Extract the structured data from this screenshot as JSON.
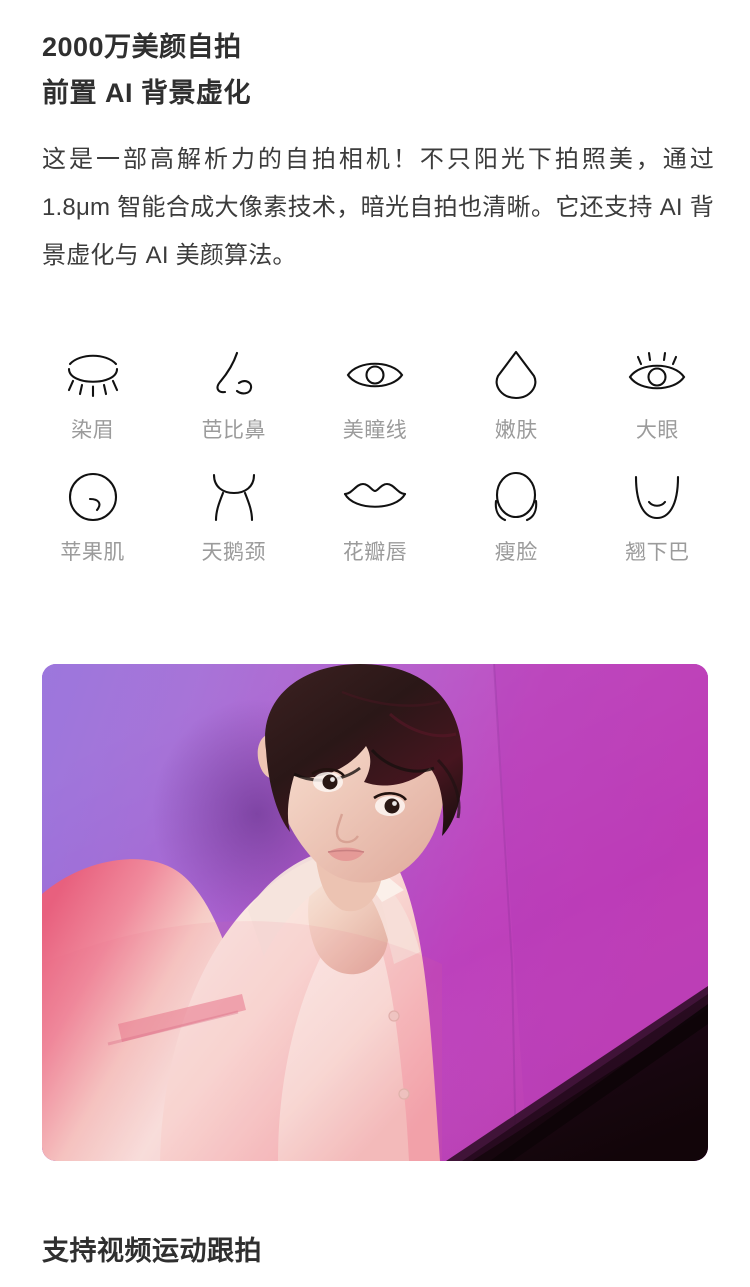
{
  "headings": {
    "line1": "2000万美颜自拍",
    "line2": "前置 AI 背景虚化",
    "bottom": "支持视频运动跟拍"
  },
  "paragraph": "这是一部高解析力的自拍相机！不只阳光下拍照美，通过 1.8μm 智能合成大像素技术，暗光自拍也清晰。它还支持 AI 背景虚化与 AI 美颜算法。",
  "features": {
    "row1": [
      {
        "label": "染眉",
        "icon": "eyebrow-lashes-icon"
      },
      {
        "label": "芭比鼻",
        "icon": "nose-icon"
      },
      {
        "label": "美瞳线",
        "icon": "eye-outline-icon"
      },
      {
        "label": "嫩肤",
        "icon": "water-drop-icon"
      },
      {
        "label": "大眼",
        "icon": "big-eye-icon"
      }
    ],
    "row2": [
      {
        "label": "苹果肌",
        "icon": "cheek-icon"
      },
      {
        "label": "天鹅颈",
        "icon": "swan-neck-icon"
      },
      {
        "label": "花瓣唇",
        "icon": "lips-icon"
      },
      {
        "label": "瘦脸",
        "icon": "slim-face-icon"
      },
      {
        "label": "翘下巴",
        "icon": "chin-icon"
      }
    ]
  },
  "photo": {
    "alt": "selfie-portrait",
    "colors": {
      "wall_left": "#9a63d4",
      "wall_right": "#b83ab8",
      "wall_mid": "#a855c8",
      "dark_corner": "#1c0a16",
      "jacket_pink": "#f2849a",
      "jacket_white": "#f7eee9",
      "skin": "#f3d8cb",
      "hair": "#2d1c1c"
    }
  },
  "colors": {
    "heading": "#2f2f2f",
    "body_text": "#3c3c3c",
    "feature_label": "#9b9b9b",
    "icon_stroke": "#111111",
    "background": "#ffffff"
  }
}
